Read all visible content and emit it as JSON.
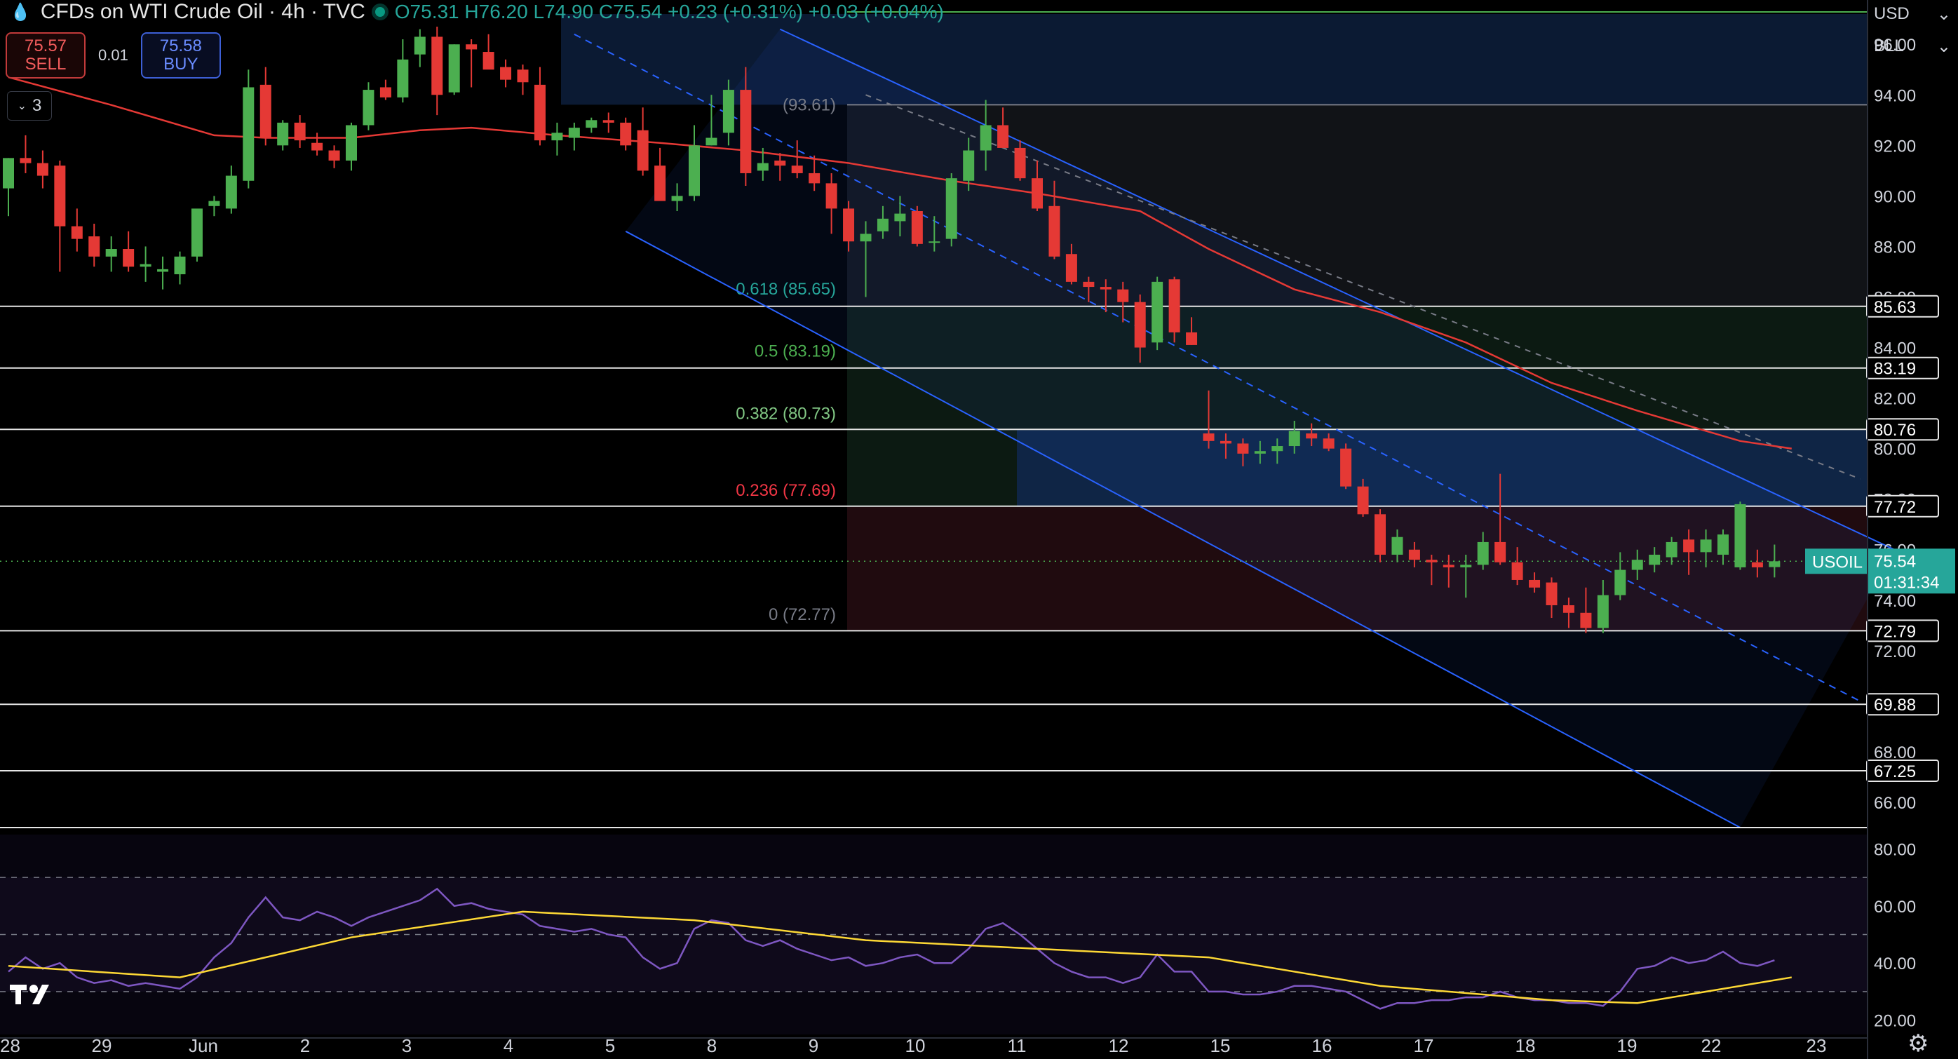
{
  "header": {
    "title": "CFDs on WTI Crude Oil · 4h · TVC",
    "open": "O75.31",
    "high": "H76.20",
    "low": "L74.90",
    "close": "C75.54",
    "change": "+0.23 (+0.31%)",
    "change2": "+0.03 (+0.04%)"
  },
  "trade": {
    "sell_price": "75.57",
    "sell_label": "SELL",
    "spread": "0.01",
    "buy_price": "75.58",
    "buy_label": "BUY"
  },
  "indicators_badge": "3",
  "currency": "USD",
  "unit": "BLL",
  "colors": {
    "up": "#4caf50",
    "down": "#e53935",
    "ma": "#e53935",
    "rsi": "#7e57c2",
    "rsi_ma": "#fdd835",
    "channel": "#2962ff"
  },
  "chart_data": {
    "type": "candlestick",
    "symbol": "USOIL",
    "last_price": "75.54",
    "countdown": "01:31:34",
    "ylim": [
      65.0,
      97.2
    ],
    "y_ticks": [
      "96.00",
      "94.00",
      "92.00",
      "90.00",
      "88.00",
      "86.00",
      "84.00",
      "82.00",
      "80.00",
      "78.00",
      "76.00",
      "74.00",
      "72.00",
      "70.00",
      "68.00",
      "66.00"
    ],
    "x_ticks": [
      "28",
      "29",
      "Jun",
      "2",
      "3",
      "4",
      "5",
      "8",
      "9",
      "10",
      "11",
      "12",
      "15",
      "16",
      "17",
      "18",
      "19",
      "22",
      "23"
    ],
    "candles": [
      [
        90.3,
        91.5,
        89.2,
        91.5
      ],
      [
        91.5,
        92.4,
        90.9,
        91.3
      ],
      [
        91.3,
        91.8,
        90.3,
        90.8
      ],
      [
        91.2,
        91.4,
        87.0,
        88.8
      ],
      [
        88.8,
        89.5,
        87.8,
        88.3
      ],
      [
        88.4,
        88.9,
        87.2,
        87.6
      ],
      [
        87.6,
        88.4,
        87.0,
        87.9
      ],
      [
        87.9,
        88.6,
        87.0,
        87.2
      ],
      [
        87.2,
        88.0,
        86.6,
        87.3
      ],
      [
        87.0,
        87.6,
        86.3,
        87.1
      ],
      [
        86.9,
        87.8,
        86.5,
        87.6
      ],
      [
        87.6,
        89.3,
        87.4,
        89.5
      ],
      [
        89.6,
        90.0,
        89.2,
        89.8
      ],
      [
        89.5,
        91.2,
        89.3,
        90.8
      ],
      [
        90.6,
        95.0,
        90.3,
        94.3
      ],
      [
        94.4,
        95.1,
        92.0,
        92.3
      ],
      [
        92.0,
        93.0,
        91.8,
        92.9
      ],
      [
        92.9,
        93.2,
        91.9,
        92.2
      ],
      [
        92.1,
        92.5,
        91.6,
        91.8
      ],
      [
        91.8,
        92.0,
        91.1,
        91.4
      ],
      [
        91.4,
        92.9,
        91.0,
        92.8
      ],
      [
        92.8,
        94.5,
        92.6,
        94.2
      ],
      [
        94.3,
        94.6,
        93.8,
        93.9
      ],
      [
        93.9,
        96.2,
        93.7,
        95.4
      ],
      [
        95.6,
        96.6,
        95.1,
        96.3
      ],
      [
        96.3,
        96.7,
        93.2,
        94.0
      ],
      [
        94.1,
        96.0,
        94.0,
        96.0
      ],
      [
        96.0,
        96.2,
        94.3,
        95.8
      ],
      [
        95.7,
        96.4,
        95.3,
        95.0
      ],
      [
        95.1,
        95.4,
        94.3,
        94.6
      ],
      [
        95.0,
        95.2,
        94.0,
        94.5
      ],
      [
        94.4,
        95.1,
        92.0,
        92.2
      ],
      [
        92.2,
        92.9,
        91.6,
        92.5
      ],
      [
        92.3,
        92.9,
        91.8,
        92.7
      ],
      [
        92.7,
        93.1,
        92.5,
        93.0
      ],
      [
        93.0,
        93.3,
        92.5,
        92.9
      ],
      [
        92.9,
        93.1,
        91.8,
        92.0
      ],
      [
        92.6,
        93.5,
        90.8,
        91.0
      ],
      [
        91.2,
        91.9,
        90.0,
        89.8
      ],
      [
        89.8,
        90.5,
        89.4,
        90.0
      ],
      [
        90.0,
        92.8,
        89.8,
        92.0
      ],
      [
        92.0,
        94.0,
        92.0,
        92.3
      ],
      [
        92.5,
        94.6,
        92.0,
        94.2
      ],
      [
        94.2,
        95.1,
        90.4,
        90.9
      ],
      [
        91.0,
        91.9,
        90.6,
        91.3
      ],
      [
        91.4,
        91.7,
        90.6,
        91.2
      ],
      [
        91.2,
        92.2,
        90.7,
        90.9
      ],
      [
        90.9,
        91.6,
        90.2,
        90.5
      ],
      [
        90.5,
        90.9,
        88.5,
        89.5
      ],
      [
        89.5,
        89.8,
        87.8,
        88.2
      ],
      [
        88.2,
        89.0,
        86.0,
        88.5
      ],
      [
        88.6,
        89.6,
        88.3,
        89.1
      ],
      [
        89.0,
        90.0,
        88.4,
        89.3
      ],
      [
        89.4,
        89.6,
        88.0,
        88.1
      ],
      [
        88.2,
        89.2,
        87.8,
        88.2
      ],
      [
        88.3,
        90.9,
        88.0,
        90.7
      ],
      [
        90.6,
        92.3,
        90.2,
        91.8
      ],
      [
        91.8,
        93.8,
        91.0,
        92.8
      ],
      [
        92.8,
        93.5,
        92.0,
        91.9
      ],
      [
        91.9,
        92.2,
        90.6,
        90.7
      ],
      [
        90.7,
        91.4,
        89.4,
        89.5
      ],
      [
        89.6,
        90.6,
        87.5,
        87.6
      ],
      [
        87.7,
        88.1,
        86.5,
        86.6
      ],
      [
        86.6,
        86.8,
        85.8,
        86.4
      ],
      [
        86.4,
        86.7,
        85.4,
        86.3
      ],
      [
        86.3,
        86.6,
        85.0,
        85.8
      ],
      [
        85.8,
        86.1,
        83.4,
        84.0
      ],
      [
        84.2,
        86.8,
        83.9,
        86.6
      ],
      [
        86.7,
        86.8,
        84.2,
        84.6
      ],
      [
        84.6,
        85.2,
        84.1,
        84.1
      ],
      [
        80.6,
        82.3,
        80.0,
        80.3
      ],
      [
        80.3,
        80.6,
        79.6,
        80.2
      ],
      [
        80.2,
        80.4,
        79.3,
        79.8
      ],
      [
        79.8,
        80.3,
        79.4,
        79.9
      ],
      [
        79.9,
        80.4,
        79.4,
        80.1
      ],
      [
        80.1,
        81.1,
        79.8,
        80.7
      ],
      [
        80.6,
        81.0,
        80.1,
        80.4
      ],
      [
        80.4,
        80.6,
        79.9,
        80.0
      ],
      [
        80.0,
        80.2,
        78.4,
        78.5
      ],
      [
        78.5,
        78.8,
        77.3,
        77.4
      ],
      [
        77.4,
        77.6,
        75.5,
        75.8
      ],
      [
        75.8,
        76.8,
        75.5,
        76.5
      ],
      [
        76.0,
        76.3,
        75.3,
        75.6
      ],
      [
        75.6,
        75.8,
        74.6,
        75.5
      ],
      [
        75.4,
        75.8,
        74.5,
        75.3
      ],
      [
        75.3,
        75.8,
        74.1,
        75.4
      ],
      [
        75.4,
        76.7,
        75.2,
        76.3
      ],
      [
        76.3,
        79.0,
        75.4,
        75.5
      ],
      [
        75.5,
        76.1,
        74.6,
        74.8
      ],
      [
        74.8,
        75.1,
        74.3,
        74.5
      ],
      [
        74.7,
        74.9,
        73.3,
        73.8
      ],
      [
        73.8,
        74.1,
        72.9,
        73.5
      ],
      [
        73.5,
        74.5,
        72.7,
        72.9
      ],
      [
        72.9,
        74.8,
        72.7,
        74.2
      ],
      [
        74.2,
        75.9,
        74.0,
        75.2
      ],
      [
        75.2,
        76.0,
        74.8,
        75.6
      ],
      [
        75.4,
        76.1,
        75.1,
        75.8
      ],
      [
        75.7,
        76.5,
        75.4,
        76.3
      ],
      [
        76.4,
        76.8,
        75.0,
        75.9
      ],
      [
        75.9,
        76.8,
        75.3,
        76.4
      ],
      [
        75.8,
        76.8,
        75.4,
        76.6
      ],
      [
        75.3,
        77.9,
        75.2,
        77.8
      ],
      [
        75.5,
        76.0,
        74.9,
        75.3
      ],
      [
        75.31,
        76.2,
        74.9,
        75.54
      ]
    ],
    "ma_line": [
      [
        0,
        94.7
      ],
      [
        6,
        93.6
      ],
      [
        12,
        92.4
      ],
      [
        15,
        92.3
      ],
      [
        20,
        92.3
      ],
      [
        24,
        92.6
      ],
      [
        27,
        92.7
      ],
      [
        32,
        92.4
      ],
      [
        38,
        92.1
      ],
      [
        43,
        91.8
      ],
      [
        49,
        91.3
      ],
      [
        55,
        90.6
      ],
      [
        60,
        90.1
      ],
      [
        66,
        89.4
      ],
      [
        70,
        87.9
      ],
      [
        75,
        86.3
      ],
      [
        80,
        85.4
      ],
      [
        85,
        84.2
      ],
      [
        90,
        82.6
      ],
      [
        95,
        81.5
      ],
      [
        101,
        80.3
      ],
      [
        104,
        80.0
      ]
    ],
    "fib_levels": [
      {
        "label": "0.618 (85.65)",
        "value": 85.65,
        "color": "#26a69a"
      },
      {
        "label": "0.5 (83.19)",
        "value": 83.19,
        "color": "#4caf50"
      },
      {
        "label": "0.382 (80.73)",
        "value": 80.73,
        "color": "#81c784"
      },
      {
        "label": "0.236 (77.69)",
        "value": 77.69,
        "color": "#f23645"
      },
      {
        "label": "0 (72.77)",
        "value": 72.77,
        "color": "#787b86"
      }
    ],
    "fib_top_label": "(93.61)",
    "fib_top_value": 93.61,
    "h_levels": [
      {
        "label": "85.63",
        "value": 85.63
      },
      {
        "label": "83.19",
        "value": 83.19
      },
      {
        "label": "80.76",
        "value": 80.76
      },
      {
        "label": "77.72",
        "value": 77.72
      },
      {
        "label": "72.79",
        "value": 72.79
      },
      {
        "label": "69.88",
        "value": 69.88
      },
      {
        "label": "67.25",
        "value": 67.25
      }
    ],
    "channel": {
      "upper": [
        [
          45,
          96.6
        ],
        [
          110,
          76.0
        ]
      ],
      "mid": [
        [
          33,
          96.4
        ],
        [
          108,
          70.0
        ]
      ],
      "lower": [
        [
          36,
          88.6
        ],
        [
          101,
          65.0
        ]
      ],
      "dashed_gray": [
        [
          50,
          94.0
        ],
        [
          108,
          78.8
        ]
      ]
    },
    "rsi": {
      "ylim": [
        15,
        85
      ],
      "y_ticks": [
        "80.00",
        "60.00",
        "40.00",
        "20.00"
      ],
      "levels": [
        70,
        50,
        30
      ],
      "values": [
        37,
        42,
        38,
        40,
        35,
        33,
        34,
        32,
        33,
        32,
        31,
        35,
        42,
        47,
        56,
        63,
        56,
        55,
        58,
        56,
        53,
        56,
        58,
        60,
        62,
        66,
        60,
        61,
        59,
        58,
        57,
        53,
        52,
        51,
        52,
        50,
        49,
        42,
        38,
        40,
        52,
        55,
        54,
        48,
        46,
        48,
        45,
        43,
        41,
        42,
        39,
        40,
        42,
        43,
        40,
        40,
        45,
        52,
        54,
        50,
        45,
        40,
        37,
        35,
        35,
        33,
        35,
        43,
        37,
        37,
        30,
        30,
        29,
        29,
        30,
        32,
        32,
        31,
        30,
        27,
        24,
        26,
        26,
        27,
        27,
        28,
        28,
        30,
        28,
        27,
        27,
        26,
        26,
        25,
        30,
        38,
        39,
        42,
        40,
        41,
        44,
        40,
        39,
        41
      ],
      "ma": [
        [
          0,
          39
        ],
        [
          10,
          35
        ],
        [
          20,
          49
        ],
        [
          30,
          58
        ],
        [
          40,
          55
        ],
        [
          50,
          48
        ],
        [
          60,
          45
        ],
        [
          70,
          42
        ],
        [
          80,
          32
        ],
        [
          90,
          27
        ],
        [
          95,
          26
        ],
        [
          100,
          31
        ],
        [
          104,
          35
        ]
      ]
    }
  }
}
